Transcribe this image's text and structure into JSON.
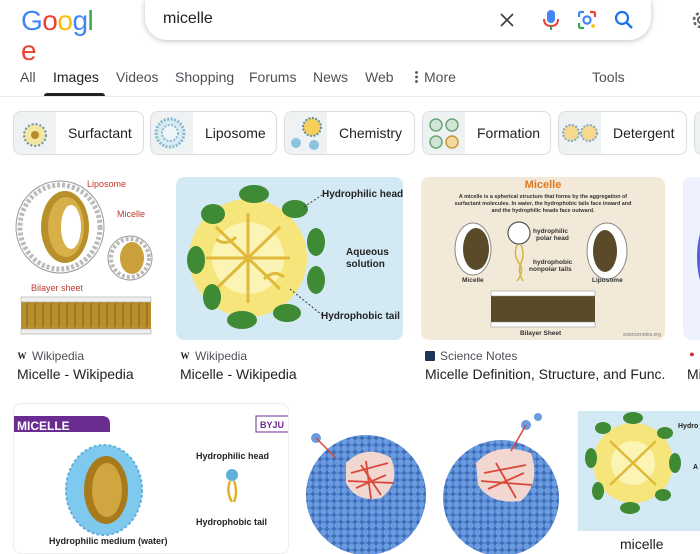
{
  "logo": {
    "letters": [
      "G",
      "o",
      "o",
      "g",
      "l",
      "e"
    ]
  },
  "search": {
    "query": "micelle"
  },
  "tabs": [
    {
      "label": "All"
    },
    {
      "label": "Images"
    },
    {
      "label": "Videos"
    },
    {
      "label": "Shopping"
    },
    {
      "label": "Forums"
    },
    {
      "label": "News"
    },
    {
      "label": "Web"
    },
    {
      "label": "More"
    },
    {
      "label": "Tools"
    }
  ],
  "chips": [
    {
      "label": "Surfactant"
    },
    {
      "label": "Liposome"
    },
    {
      "label": "Chemistry"
    },
    {
      "label": "Formation"
    },
    {
      "label": "Detergent"
    }
  ],
  "results": [
    {
      "source": "Wikipedia",
      "title": "Micelle - Wikipedia",
      "labels": {
        "liposome": "Liposome",
        "micelle": "Micelle",
        "bilayer": "Bilayer sheet"
      }
    },
    {
      "source": "Wikipedia",
      "title": "Micelle - Wikipedia",
      "labels": {
        "head": "Hydrophilic head",
        "aqueous1": "Aqueous",
        "aqueous2": "solution",
        "tail": "Hydrophobic tail"
      }
    },
    {
      "source": "Science Notes",
      "title": "Micelle Definition, Structure, and Func...",
      "labels": {
        "heading": "Micelle",
        "desc1": "A micelle is a spherical structure that forms by the aggregation of",
        "desc2": "surfactant molecules. In water, the hydrophobic tails face inward and",
        "desc3": "and the hydrophilic heads face outward.",
        "polar1": "hydrophilic",
        "polar2": "polar head",
        "nonpolar1": "hydrophobic",
        "nonpolar2": "nonpolar tails",
        "micelle": "Micelle",
        "liposome": "Liposome",
        "bilayer": "Bilayer Sheet",
        "watermark": "sciencenotes.org"
      }
    },
    {
      "source": "",
      "title": "Mi"
    },
    {
      "labels": {
        "banner": "MICELLE",
        "brand": "BYJU",
        "head": "Hydrophilic head",
        "tail": "Hydrophobic tail",
        "medium": "Hydrophilic medium (water)"
      }
    },
    {
      "labels": {}
    },
    {
      "labels": {
        "head": "Hydro",
        "aq": "A",
        "caption": "micelle"
      }
    }
  ],
  "colors": {
    "accent_blue": "#1a73e8",
    "text": "#202124",
    "muted": "#4d5156",
    "border": "#dadce0"
  }
}
